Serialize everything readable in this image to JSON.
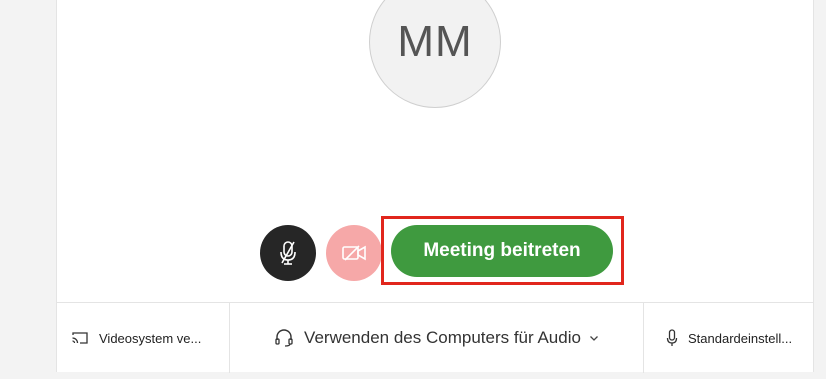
{
  "avatar": {
    "initials": "MM"
  },
  "controls": {
    "mute_icon": "microphone-muted-icon",
    "video_icon": "video-off-icon",
    "join_label": "Meeting beitreten",
    "colors": {
      "join": "#3f9a3f",
      "highlight": "#e1261c",
      "mute_bg": "#262626",
      "video_bg": "#f6a8a8"
    }
  },
  "bottom_bar": {
    "video_system": {
      "icon": "cast-screen-icon",
      "label": "Videosystem ve..."
    },
    "audio": {
      "icon": "headset-icon",
      "label": "Verwenden des Computers für Audio",
      "chevron_icon": "chevron-down-icon"
    },
    "microphone": {
      "icon": "microphone-icon",
      "label": "Standardeinstell..."
    }
  }
}
